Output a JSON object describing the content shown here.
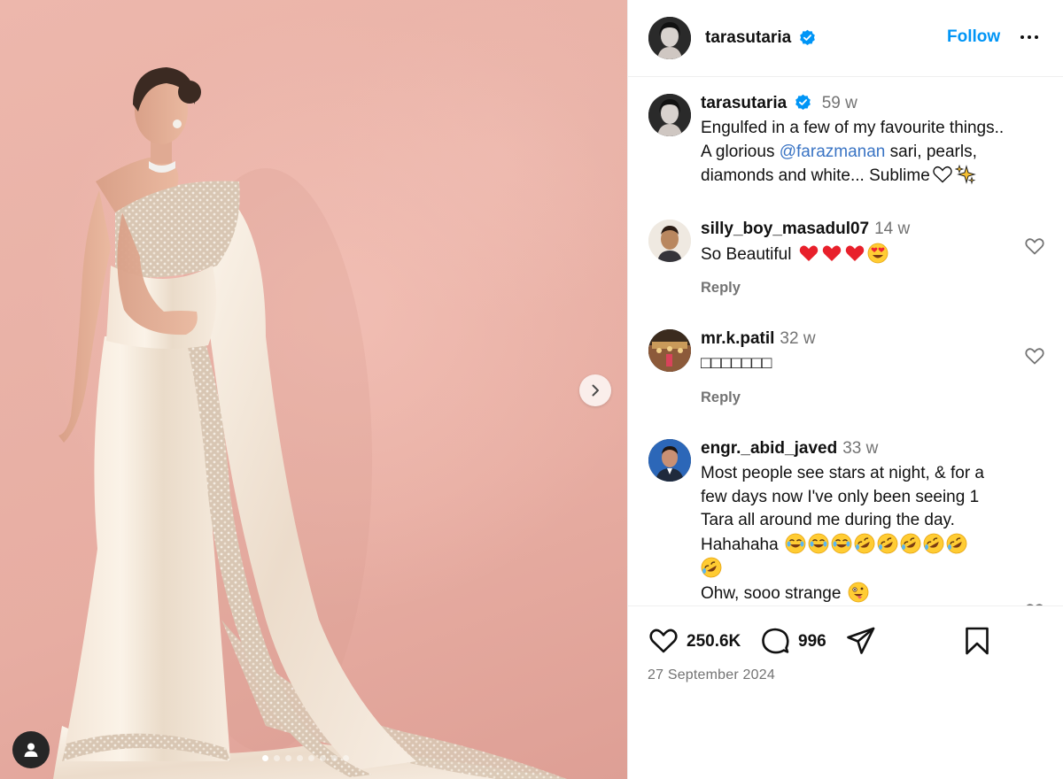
{
  "post": {
    "author": "tarasutaria",
    "follow_label": "Follow",
    "caption": {
      "author": "tarasutaria",
      "time": "59 w",
      "lines": [
        "Engulfed in a few of my favourite things..",
        "sari, pearls,",
        "diamonds and white... Sublime"
      ],
      "line2_prefix": "A glorious ",
      "mention": "@farazmanan",
      "emojis": [
        "white-heart",
        "sparkles"
      ]
    },
    "carousel": {
      "slides": 8,
      "active_index": 0
    }
  },
  "comments": [
    {
      "user": "silly_boy_masadul07",
      "time": "14 w",
      "lines": [
        "So Beautiful"
      ],
      "emojis": [
        "red-heart",
        "red-heart",
        "red-heart",
        "heart-eyes"
      ],
      "reply_label": "Reply"
    },
    {
      "user": "mr.k.patil",
      "time": "32 w",
      "lines": [
        "□□□□□□□"
      ],
      "reply_label": "Reply"
    },
    {
      "user": "engr._abid_javed",
      "time": "33 w",
      "lines": [
        "Most people see stars at night, & for a",
        "few days now I've only been seeing 1",
        "Tara all around me during the day.",
        "Hahahaha",
        "Ohw, sooo strange"
      ],
      "emojis": [
        "joy",
        "joy",
        "joy",
        "rofl",
        "rofl",
        "rofl",
        "rofl",
        "rofl",
        "rofl",
        "zany"
      ]
    }
  ],
  "stats": {
    "likes": "250.6K",
    "comments": "996",
    "date": "27 September 2024"
  },
  "colors": {
    "accent": "#0095f6",
    "verified": "#0095f6",
    "muted": "#737373",
    "mention": "#3a74c4"
  },
  "icons": [
    "verified-badge-icon",
    "more-icon",
    "heart-icon",
    "comment-icon",
    "share-icon",
    "bookmark-icon",
    "chevron-right-icon",
    "person-icon"
  ]
}
